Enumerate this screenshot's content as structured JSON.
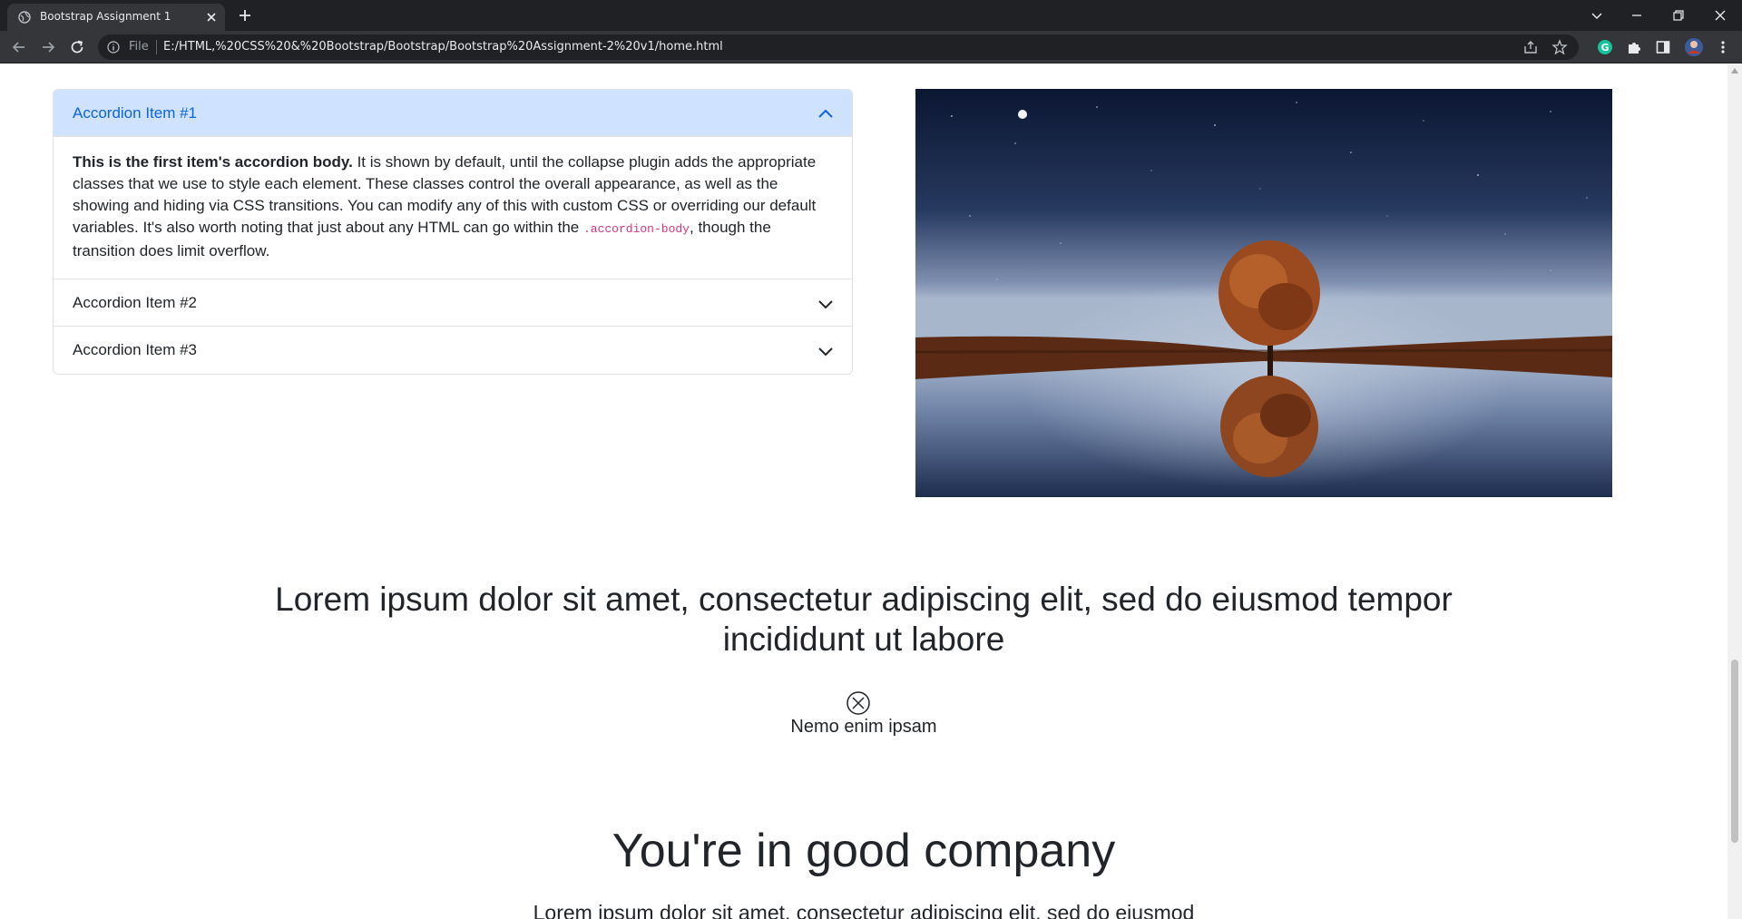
{
  "browser": {
    "tab_title": "Bootstrap Assignment 1",
    "url_scheme": "File",
    "url": "E:/HTML,%20CSS%20&%20Bootstrap/Bootstrap/Bootstrap%20Assignment-2%20v1/home.html",
    "extension_badge": "G"
  },
  "accordion": {
    "items": [
      {
        "title": "Accordion Item #1",
        "expanded": true,
        "body_strong": "This is the first item's accordion body.",
        "body_text_1": " It is shown by default, until the collapse plugin adds the appropriate classes that we use to style each element. These classes control the overall appearance, as well as the showing and hiding via CSS transitions. You can modify any of this with custom CSS or overriding our default variables. It's also worth noting that just about any HTML can go within the ",
        "body_code": ".accordion-body",
        "body_text_2": ", though the transition does limit overflow."
      },
      {
        "title": "Accordion Item #2",
        "expanded": false
      },
      {
        "title": "Accordion Item #3",
        "expanded": false
      }
    ]
  },
  "hero_text": {
    "heading": "Lorem ipsum dolor sit amet, consectetur adipiscing elit, sed do eiusmod tempor incididunt ut labore",
    "caption": "Nemo enim ipsam"
  },
  "company": {
    "heading": "You're in good company",
    "subtext": "Lorem ipsum dolor sit amet, consectetur adipiscing elit, sed do eiusmod"
  },
  "colors": {
    "accordion_active_bg": "#cfe2ff",
    "accordion_active_text": "#0c63e4",
    "code_pink": "#d63384",
    "chrome_dark": "#202124",
    "chrome_toolbar": "#35363a"
  },
  "icons": {
    "image": "night-tree-reflection-image",
    "decorative": "circle-x-icon"
  }
}
